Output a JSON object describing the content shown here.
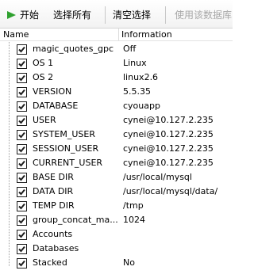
{
  "toolbar": {
    "start_label": "开始",
    "select_all_label": "选择所有",
    "clear_selection_label": "清空选择",
    "use_db_label": "使用该数据库"
  },
  "columns": {
    "name": "Name",
    "information": "Information"
  },
  "rows": [
    {
      "name": "magic_quotes_gpc",
      "info": "Off",
      "checked": true
    },
    {
      "name": "OS 1",
      "info": "Linux",
      "checked": true
    },
    {
      "name": "OS 2",
      "info": "linux2.6",
      "checked": true
    },
    {
      "name": "VERSION",
      "info": "5.5.35",
      "checked": true
    },
    {
      "name": "DATABASE",
      "info": "cyouapp",
      "checked": true
    },
    {
      "name": "USER",
      "info": "cynei@10.127.2.235",
      "checked": true
    },
    {
      "name": "SYSTEM_USER",
      "info": "cynei@10.127.2.235",
      "checked": true
    },
    {
      "name": "SESSION_USER",
      "info": "cynei@10.127.2.235",
      "checked": true
    },
    {
      "name": "CURRENT_USER",
      "info": "cynei@10.127.2.235",
      "checked": true
    },
    {
      "name": "BASE DIR",
      "info": "/usr/local/mysql",
      "checked": true
    },
    {
      "name": "DATA DIR",
      "info": "/usr/local/mysql/data/",
      "checked": true
    },
    {
      "name": "TEMP DIR",
      "info": "/tmp",
      "checked": true
    },
    {
      "name": "group_concat_ma...",
      "info": "1024",
      "checked": true
    },
    {
      "name": "Accounts",
      "info": "",
      "checked": true
    },
    {
      "name": "Databases",
      "info": "",
      "checked": true
    },
    {
      "name": "Stacked",
      "info": "No",
      "checked": true
    }
  ]
}
